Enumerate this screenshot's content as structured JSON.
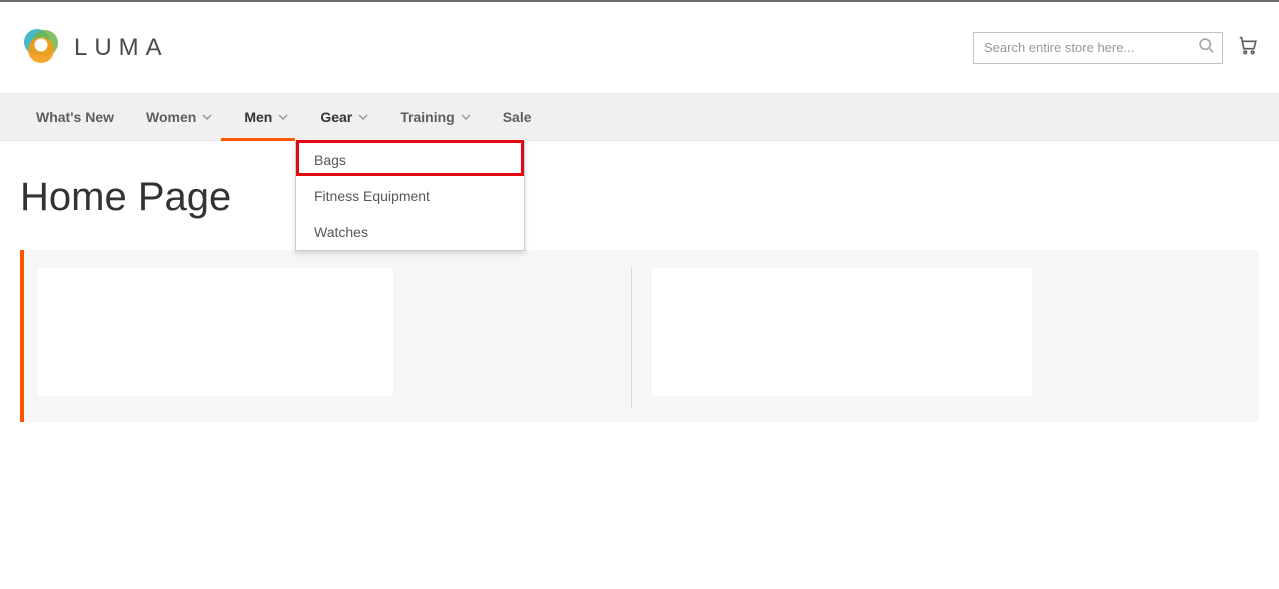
{
  "brand": {
    "name": "LUMA"
  },
  "search": {
    "placeholder": "Search entire store here..."
  },
  "nav": {
    "items": [
      {
        "label": "What's New",
        "hasDropdown": false
      },
      {
        "label": "Women",
        "hasDropdown": true
      },
      {
        "label": "Men",
        "hasDropdown": true
      },
      {
        "label": "Gear",
        "hasDropdown": true
      },
      {
        "label": "Training",
        "hasDropdown": true
      },
      {
        "label": "Sale",
        "hasDropdown": false
      }
    ]
  },
  "gear_dropdown": {
    "items": [
      {
        "label": "Bags"
      },
      {
        "label": "Fitness Equipment"
      },
      {
        "label": "Watches"
      }
    ]
  },
  "page": {
    "title": "Home Page"
  }
}
